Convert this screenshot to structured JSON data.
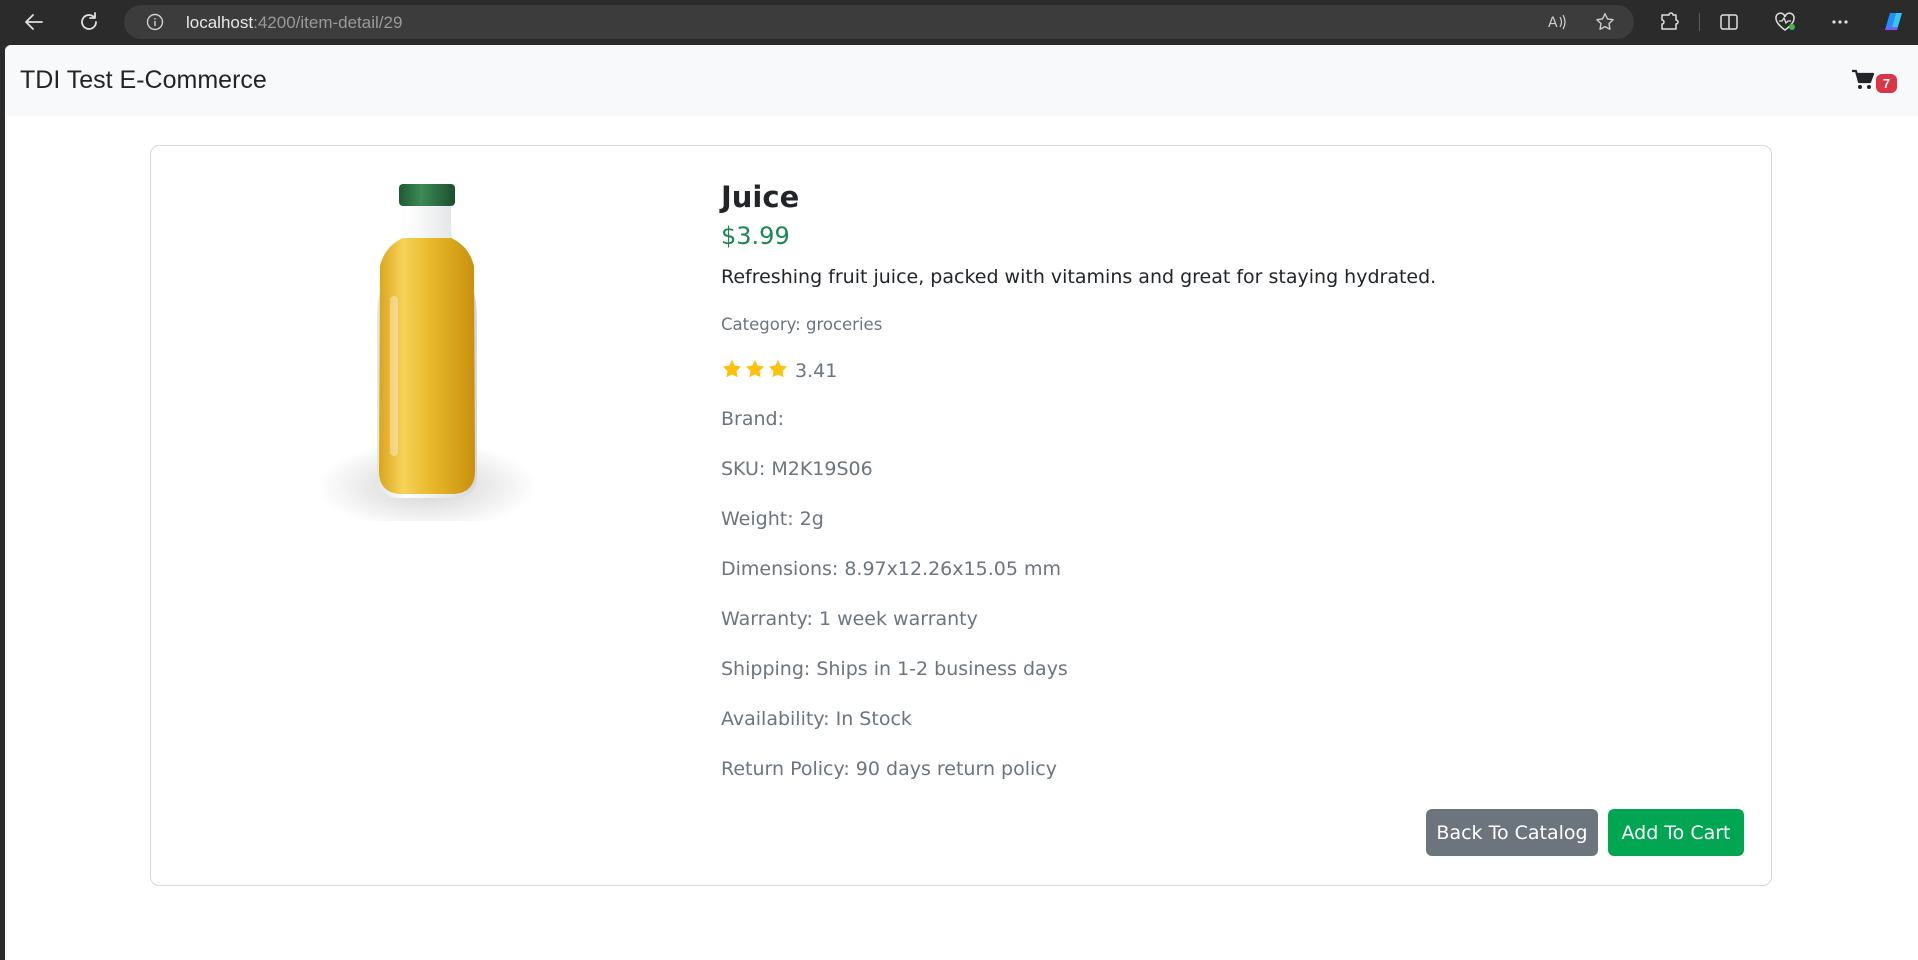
{
  "browser": {
    "url_host": "localhost",
    "url_path": ":4200/item-detail/29",
    "icons": [
      "back-icon",
      "refresh-icon",
      "info-icon",
      "read-aloud-icon",
      "favorite-star-icon",
      "extensions-icon",
      "split-screen-icon",
      "browser-essentials-icon",
      "more-icon",
      "copilot-icon"
    ]
  },
  "navbar": {
    "brand": "TDI Test E-Commerce",
    "cart_count": "7"
  },
  "product": {
    "title": "Juice",
    "price": "$3.99",
    "description": "Refreshing fruit juice, packed with vitamins and great for staying hydrated.",
    "category": "Category: groceries",
    "rating": 3.41,
    "rating_text": "3.41",
    "rating_stars_shown": 3,
    "brand": "Brand:",
    "sku": "SKU: M2K19S06",
    "weight": "Weight: 2g",
    "dimensions": "Dimensions: 8.97x12.26x15.05 mm",
    "warranty": "Warranty: 1 week warranty",
    "shipping": "Shipping: Ships in 1-2 business days",
    "availability": "Availability: In Stock",
    "return_policy": "Return Policy: 90 days return policy"
  },
  "actions": {
    "back_label": "Back To Catalog",
    "add_label": "Add To Cart"
  },
  "colors": {
    "price": "#198754",
    "star": "#ffc107",
    "badge": "#dc3545",
    "back_button": "#6c757d",
    "add_button": "#00a651"
  }
}
